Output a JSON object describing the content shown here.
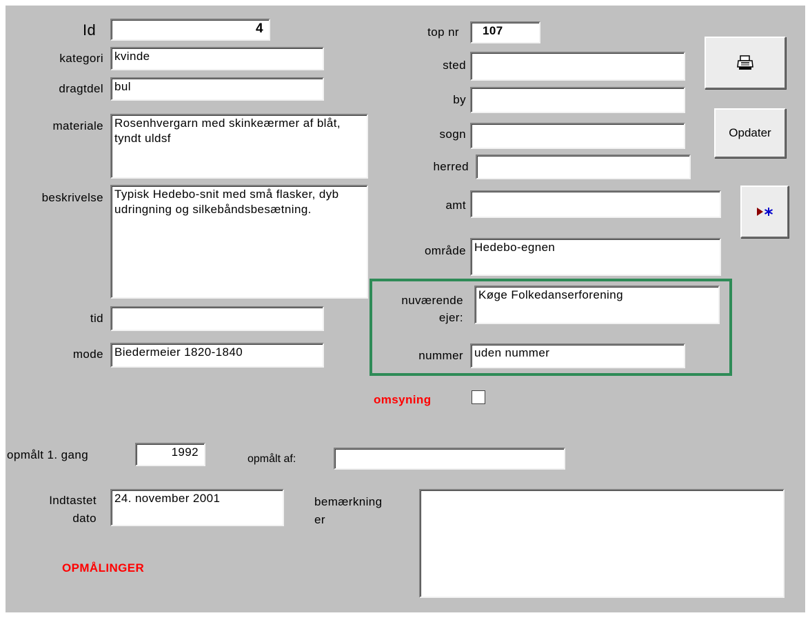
{
  "left": {
    "id_label": "Id",
    "id_value": "4",
    "kategori_label": "kategori",
    "kategori_value": "kvinde",
    "dragtdel_label": "dragtdel",
    "dragtdel_value": "bul",
    "materiale_label": "materiale",
    "materiale_value": "Rosenhvergarn med skinkeærmer af blåt, tyndt uldsf",
    "beskrivelse_label": "beskrivelse",
    "beskrivelse_value": "Typisk Hedebo-snit med små flasker, dyb udringning og silkebåndsbesætning.",
    "tid_label": "tid",
    "tid_value": "",
    "mode_label": "mode",
    "mode_value": "Biedermeier 1820-1840"
  },
  "right": {
    "topnr_label": "top nr",
    "topnr_value": "107",
    "sted_label": "sted",
    "sted_value": "",
    "by_label": "by",
    "by_value": "",
    "sogn_label": "sogn",
    "sogn_value": "",
    "herred_label": "herred",
    "herred_value": "",
    "amt_label": "amt",
    "amt_value": "",
    "omraade_label": "område",
    "omraade_value": "Hedebo-egnen",
    "ejer_label_1": "nuværende",
    "ejer_label_2": "ejer:",
    "ejer_value": "Køge Folkedanserforening",
    "nummer_label": "nummer",
    "nummer_value": "uden nummer",
    "omsyning_label": "omsyning",
    "omsyning_checked": false
  },
  "buttons": {
    "print_icon": "printer-icon",
    "opdater_label": "Opdater",
    "new_record_icon": "new-record-icon"
  },
  "bottom": {
    "opmaalt_label": "opmålt 1. gang",
    "opmaalt_value": "1992",
    "opmaalt_af_label": "opmålt af:",
    "opmaalt_af_value": "",
    "indtastet_label_1": "Indtastet",
    "indtastet_label_2": "dato",
    "indtastet_value": "24. november 2001",
    "bemaerkninger_label_1": "bemærkning",
    "bemaerkninger_label_2": "er",
    "bemaerkninger_value": "",
    "opmaalinger_label": "OPMÅLINGER"
  },
  "colors": {
    "form_bg": "#c0c0c0",
    "group_border": "#2e8b57",
    "accent_red": "#ff0000",
    "new_record_arrow": "#8b0000",
    "new_record_star": "#0000cc"
  }
}
